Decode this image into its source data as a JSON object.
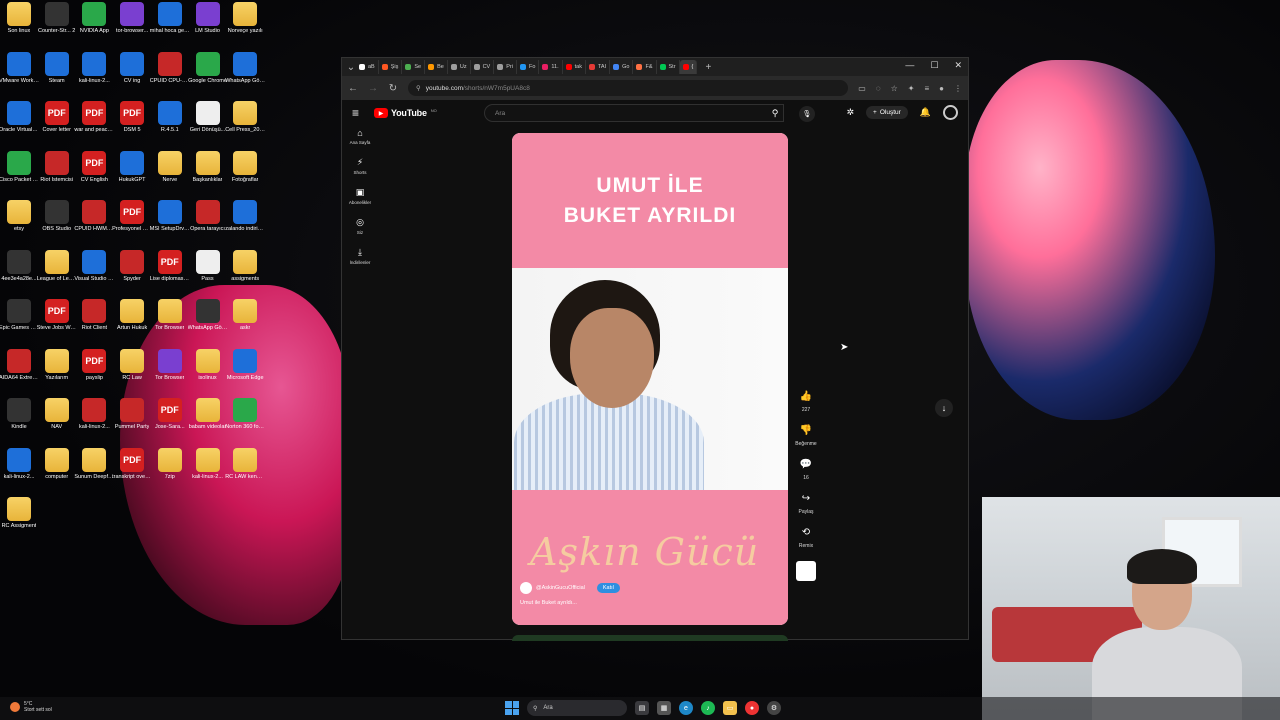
{
  "desktop": {
    "icons": [
      {
        "label": "Son linux",
        "type": "folder"
      },
      {
        "label": "Counter-Str... 2",
        "type": "dark"
      },
      {
        "label": "NVIDIA App",
        "type": "green"
      },
      {
        "label": "tor-browser...",
        "type": "purple"
      },
      {
        "label": "mihal hoca geri dönüş",
        "type": "blue"
      },
      {
        "label": "LM Studio",
        "type": "purple"
      },
      {
        "label": "Norveçe yazılı",
        "type": "folder"
      },
      {
        "label": "VMware Workstati...",
        "type": "blue"
      },
      {
        "label": "Steam",
        "type": "blue"
      },
      {
        "label": "kali-linux-2...",
        "type": "blue"
      },
      {
        "label": "CV ing",
        "type": "blue"
      },
      {
        "label": "CPUID CPU-Z MSI",
        "type": "red"
      },
      {
        "label": "Google Chrome",
        "type": "green"
      },
      {
        "label": "WhatsApp Görsel 2025...",
        "type": "blue"
      },
      {
        "label": "Oracle VirtualBox",
        "type": "blue"
      },
      {
        "label": "Cover letter",
        "type": "pdf"
      },
      {
        "label": "war and peace pdf",
        "type": "pdf"
      },
      {
        "label": "DSM 5",
        "type": "pdf"
      },
      {
        "label": "R.4.5.1",
        "type": "blue"
      },
      {
        "label": "Geri Dönüşü...",
        "type": "white"
      },
      {
        "label": "Cell Press_2025...",
        "type": "folder"
      },
      {
        "label": "Cisco Packet Tracer",
        "type": "green"
      },
      {
        "label": "Riot İstemcisi",
        "type": "red"
      },
      {
        "label": "CV English",
        "type": "pdf"
      },
      {
        "label": "HukukGPT",
        "type": "blue"
      },
      {
        "label": "Nerve",
        "type": "folder"
      },
      {
        "label": "Başkanlıklar",
        "type": "folder"
      },
      {
        "label": "Fotoğraflar",
        "type": "folder"
      },
      {
        "label": "etsy",
        "type": "folder"
      },
      {
        "label": "OBS Studio",
        "type": "dark"
      },
      {
        "label": "CPUID HWMonitor",
        "type": "red"
      },
      {
        "label": "Profesyonel CV norsk",
        "type": "pdf"
      },
      {
        "label": "MSI SetupDrv64",
        "type": "blue"
      },
      {
        "label": "Opera tarayıcı",
        "type": "red"
      },
      {
        "label": "zalando indirim kodu",
        "type": "blue"
      },
      {
        "label": "4ee3e4a28e...",
        "type": "dark"
      },
      {
        "label": "League of Legends",
        "type": "folder"
      },
      {
        "label": "Visual Studio Code",
        "type": "blue"
      },
      {
        "label": "Spyder",
        "type": "red"
      },
      {
        "label": "Lise diploması_(1)",
        "type": "pdf"
      },
      {
        "label": "Pass",
        "type": "white"
      },
      {
        "label": "assigments",
        "type": "folder"
      },
      {
        "label": "Epic Games Launcher",
        "type": "dark"
      },
      {
        "label": "Steve Jobs Walter Is...",
        "type": "pdf"
      },
      {
        "label": "Riot Client",
        "type": "red"
      },
      {
        "label": "Artun Hukuk",
        "type": "folder"
      },
      {
        "label": "Tor Browser",
        "type": "folder"
      },
      {
        "label": "WhatsApp Görsel 202...",
        "type": "dark"
      },
      {
        "label": "askr",
        "type": "folder"
      },
      {
        "label": "AIDA64 Extreme",
        "type": "red"
      },
      {
        "label": "Yazılarım",
        "type": "folder"
      },
      {
        "label": "payslip",
        "type": "pdf"
      },
      {
        "label": "RC Law",
        "type": "folder"
      },
      {
        "label": "Tor Browser",
        "type": "purple"
      },
      {
        "label": "isolinux",
        "type": "folder"
      },
      {
        "label": "Microsoft Edge",
        "type": "blue"
      },
      {
        "label": "Kindle",
        "type": "dark"
      },
      {
        "label": "NAV",
        "type": "folder"
      },
      {
        "label": "kali-linux-2...",
        "type": "red"
      },
      {
        "label": "Pummel Party",
        "type": "red"
      },
      {
        "label": "Jose-Sara...",
        "type": "pdf"
      },
      {
        "label": "babam videolar",
        "type": "folder"
      },
      {
        "label": "Norton 360 for Gamers",
        "type": "green"
      },
      {
        "label": "kali-linux-2...",
        "type": "blue"
      },
      {
        "label": "computer",
        "type": "folder"
      },
      {
        "label": "Sunum Deepfake",
        "type": "folder"
      },
      {
        "label": "transkript oversatt...",
        "type": "pdf"
      },
      {
        "label": "7zip",
        "type": "folder"
      },
      {
        "label": "kali-linux-2...",
        "type": "folder"
      },
      {
        "label": "RC LAW kendi ASSI...",
        "type": "folder"
      },
      {
        "label": "RC Assigment",
        "type": "folder"
      }
    ]
  },
  "browser": {
    "tabs": [
      {
        "label": "aB",
        "color": "#ffffff"
      },
      {
        "label": "Şiş",
        "color": "#ff5722"
      },
      {
        "label": "Se",
        "color": "#4caf50"
      },
      {
        "label": "Be",
        "color": "#ff9800"
      },
      {
        "label": "Uz",
        "color": "#9e9e9e"
      },
      {
        "label": "CV",
        "color": "#9e9e9e"
      },
      {
        "label": "Pri",
        "color": "#9e9e9e"
      },
      {
        "label": "Fo",
        "color": "#2196f3"
      },
      {
        "label": "11.",
        "color": "#e91e63"
      },
      {
        "label": "tak",
        "color": "#ff0000"
      },
      {
        "label": "TAI",
        "color": "#e53935"
      },
      {
        "label": "Go",
        "color": "#4285f4"
      },
      {
        "label": "F&",
        "color": "#ff7043"
      },
      {
        "label": "Str",
        "color": "#00c853"
      },
      {
        "label": "(",
        "color": "#ff0000"
      }
    ],
    "url_host": "youtube.com",
    "url_path": "/shorts/nW7m5pUA8c8",
    "new_tab": "+",
    "controls": {
      "minimize": "—",
      "maximize": "☐",
      "close": "✕"
    }
  },
  "youtube": {
    "logo_text": "YouTube",
    "logo_suffix": "NO",
    "search_placeholder": "Ara",
    "create_label": "Oluştur",
    "guide": [
      {
        "icon": "home-icon",
        "glyph": "⌂",
        "label": "Ana Sayfa"
      },
      {
        "icon": "shorts-icon",
        "glyph": "⚡",
        "label": "Shorts"
      },
      {
        "icon": "subscriptions-icon",
        "glyph": "▣",
        "label": "Abonelikler"
      },
      {
        "icon": "you-icon",
        "glyph": "◎",
        "label": "Siz"
      },
      {
        "icon": "downloads-icon",
        "glyph": "⤓",
        "label": "İndirilenler"
      }
    ],
    "short": {
      "title_line1": "UMUT İLE",
      "title_line2": "BUKET AYRILDI",
      "script_text": "Aşkın Gücü",
      "channel": "@AskinGucuOfficial",
      "join_label": "Katıl",
      "caption": "Umut ile Buket ayrıldı..."
    },
    "actions": {
      "like_count": "227",
      "dislike_label": "Beğenme",
      "comment_count": "16",
      "share_label": "Paylaş",
      "remix_label": "Remix"
    }
  },
  "taskbar": {
    "weather_temp": "5°C",
    "weather_desc": "Stort sett sol",
    "search_placeholder": "Ara"
  },
  "colors": {
    "short_pink": "#f38aa6",
    "youtube_red": "#ff0000",
    "join_blue": "#2e8fe0"
  }
}
